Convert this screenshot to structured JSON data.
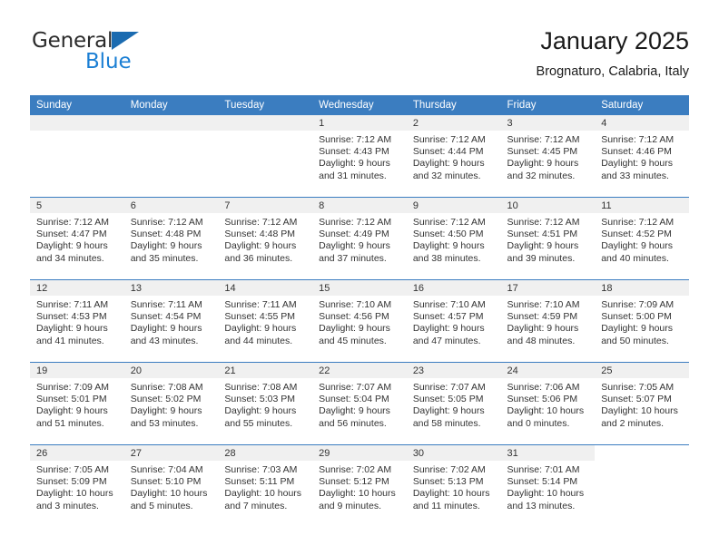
{
  "brand": {
    "name_top": "General",
    "name_bottom": "Blue",
    "triangle_color": "#1b6bb0",
    "blue_color": "#1b7fd4"
  },
  "header": {
    "title": "January 2025",
    "subtitle": "Brognaturo, Calabria, Italy"
  },
  "theme": {
    "header_blue": "#3b7dc0",
    "day_band_gray": "#f0f0f0",
    "text": "#333333"
  },
  "weekday_headers": [
    "Sunday",
    "Monday",
    "Tuesday",
    "Wednesday",
    "Thursday",
    "Friday",
    "Saturday"
  ],
  "labels": {
    "sunrise_prefix": "Sunrise:",
    "sunset_prefix": "Sunset:",
    "daylight_prefix": "Daylight:"
  },
  "weeks": [
    {
      "days": [
        {
          "num": "",
          "blank": true,
          "band": "gray",
          "lines": []
        },
        {
          "num": "",
          "blank": true,
          "band": "gray",
          "lines": []
        },
        {
          "num": "",
          "blank": true,
          "band": "gray",
          "lines": []
        },
        {
          "num": "1",
          "blank": false,
          "band": "gray",
          "lines": [
            "Sunrise: 7:12 AM",
            "Sunset: 4:43 PM",
            "Daylight: 9 hours",
            "and 31 minutes."
          ]
        },
        {
          "num": "2",
          "blank": false,
          "band": "gray",
          "lines": [
            "Sunrise: 7:12 AM",
            "Sunset: 4:44 PM",
            "Daylight: 9 hours",
            "and 32 minutes."
          ]
        },
        {
          "num": "3",
          "blank": false,
          "band": "gray",
          "lines": [
            "Sunrise: 7:12 AM",
            "Sunset: 4:45 PM",
            "Daylight: 9 hours",
            "and 32 minutes."
          ]
        },
        {
          "num": "4",
          "blank": false,
          "band": "gray",
          "lines": [
            "Sunrise: 7:12 AM",
            "Sunset: 4:46 PM",
            "Daylight: 9 hours",
            "and 33 minutes."
          ]
        }
      ]
    },
    {
      "days": [
        {
          "num": "5",
          "blank": false,
          "band": "gray",
          "lines": [
            "Sunrise: 7:12 AM",
            "Sunset: 4:47 PM",
            "Daylight: 9 hours",
            "and 34 minutes."
          ]
        },
        {
          "num": "6",
          "blank": false,
          "band": "gray",
          "lines": [
            "Sunrise: 7:12 AM",
            "Sunset: 4:48 PM",
            "Daylight: 9 hours",
            "and 35 minutes."
          ]
        },
        {
          "num": "7",
          "blank": false,
          "band": "gray",
          "lines": [
            "Sunrise: 7:12 AM",
            "Sunset: 4:48 PM",
            "Daylight: 9 hours",
            "and 36 minutes."
          ]
        },
        {
          "num": "8",
          "blank": false,
          "band": "gray",
          "lines": [
            "Sunrise: 7:12 AM",
            "Sunset: 4:49 PM",
            "Daylight: 9 hours",
            "and 37 minutes."
          ]
        },
        {
          "num": "9",
          "blank": false,
          "band": "gray",
          "lines": [
            "Sunrise: 7:12 AM",
            "Sunset: 4:50 PM",
            "Daylight: 9 hours",
            "and 38 minutes."
          ]
        },
        {
          "num": "10",
          "blank": false,
          "band": "gray",
          "lines": [
            "Sunrise: 7:12 AM",
            "Sunset: 4:51 PM",
            "Daylight: 9 hours",
            "and 39 minutes."
          ]
        },
        {
          "num": "11",
          "blank": false,
          "band": "gray",
          "lines": [
            "Sunrise: 7:12 AM",
            "Sunset: 4:52 PM",
            "Daylight: 9 hours",
            "and 40 minutes."
          ]
        }
      ]
    },
    {
      "days": [
        {
          "num": "12",
          "blank": false,
          "band": "gray",
          "lines": [
            "Sunrise: 7:11 AM",
            "Sunset: 4:53 PM",
            "Daylight: 9 hours",
            "and 41 minutes."
          ]
        },
        {
          "num": "13",
          "blank": false,
          "band": "gray",
          "lines": [
            "Sunrise: 7:11 AM",
            "Sunset: 4:54 PM",
            "Daylight: 9 hours",
            "and 43 minutes."
          ]
        },
        {
          "num": "14",
          "blank": false,
          "band": "gray",
          "lines": [
            "Sunrise: 7:11 AM",
            "Sunset: 4:55 PM",
            "Daylight: 9 hours",
            "and 44 minutes."
          ]
        },
        {
          "num": "15",
          "blank": false,
          "band": "gray",
          "lines": [
            "Sunrise: 7:10 AM",
            "Sunset: 4:56 PM",
            "Daylight: 9 hours",
            "and 45 minutes."
          ]
        },
        {
          "num": "16",
          "blank": false,
          "band": "gray",
          "lines": [
            "Sunrise: 7:10 AM",
            "Sunset: 4:57 PM",
            "Daylight: 9 hours",
            "and 47 minutes."
          ]
        },
        {
          "num": "17",
          "blank": false,
          "band": "gray",
          "lines": [
            "Sunrise: 7:10 AM",
            "Sunset: 4:59 PM",
            "Daylight: 9 hours",
            "and 48 minutes."
          ]
        },
        {
          "num": "18",
          "blank": false,
          "band": "gray",
          "lines": [
            "Sunrise: 7:09 AM",
            "Sunset: 5:00 PM",
            "Daylight: 9 hours",
            "and 50 minutes."
          ]
        }
      ]
    },
    {
      "days": [
        {
          "num": "19",
          "blank": false,
          "band": "gray",
          "lines": [
            "Sunrise: 7:09 AM",
            "Sunset: 5:01 PM",
            "Daylight: 9 hours",
            "and 51 minutes."
          ]
        },
        {
          "num": "20",
          "blank": false,
          "band": "gray",
          "lines": [
            "Sunrise: 7:08 AM",
            "Sunset: 5:02 PM",
            "Daylight: 9 hours",
            "and 53 minutes."
          ]
        },
        {
          "num": "21",
          "blank": false,
          "band": "gray",
          "lines": [
            "Sunrise: 7:08 AM",
            "Sunset: 5:03 PM",
            "Daylight: 9 hours",
            "and 55 minutes."
          ]
        },
        {
          "num": "22",
          "blank": false,
          "band": "gray",
          "lines": [
            "Sunrise: 7:07 AM",
            "Sunset: 5:04 PM",
            "Daylight: 9 hours",
            "and 56 minutes."
          ]
        },
        {
          "num": "23",
          "blank": false,
          "band": "gray",
          "lines": [
            "Sunrise: 7:07 AM",
            "Sunset: 5:05 PM",
            "Daylight: 9 hours",
            "and 58 minutes."
          ]
        },
        {
          "num": "24",
          "blank": false,
          "band": "gray",
          "lines": [
            "Sunrise: 7:06 AM",
            "Sunset: 5:06 PM",
            "Daylight: 10 hours",
            "and 0 minutes."
          ]
        },
        {
          "num": "25",
          "blank": false,
          "band": "gray",
          "lines": [
            "Sunrise: 7:05 AM",
            "Sunset: 5:07 PM",
            "Daylight: 10 hours",
            "and 2 minutes."
          ]
        }
      ]
    },
    {
      "days": [
        {
          "num": "26",
          "blank": false,
          "band": "gray",
          "lines": [
            "Sunrise: 7:05 AM",
            "Sunset: 5:09 PM",
            "Daylight: 10 hours",
            "and 3 minutes."
          ]
        },
        {
          "num": "27",
          "blank": false,
          "band": "gray",
          "lines": [
            "Sunrise: 7:04 AM",
            "Sunset: 5:10 PM",
            "Daylight: 10 hours",
            "and 5 minutes."
          ]
        },
        {
          "num": "28",
          "blank": false,
          "band": "gray",
          "lines": [
            "Sunrise: 7:03 AM",
            "Sunset: 5:11 PM",
            "Daylight: 10 hours",
            "and 7 minutes."
          ]
        },
        {
          "num": "29",
          "blank": false,
          "band": "gray",
          "lines": [
            "Sunrise: 7:02 AM",
            "Sunset: 5:12 PM",
            "Daylight: 10 hours",
            "and 9 minutes."
          ]
        },
        {
          "num": "30",
          "blank": false,
          "band": "gray",
          "lines": [
            "Sunrise: 7:02 AM",
            "Sunset: 5:13 PM",
            "Daylight: 10 hours",
            "and 11 minutes."
          ]
        },
        {
          "num": "31",
          "blank": false,
          "band": "gray",
          "lines": [
            "Sunrise: 7:01 AM",
            "Sunset: 5:14 PM",
            "Daylight: 10 hours",
            "and 13 minutes."
          ]
        },
        {
          "num": "",
          "blank": true,
          "band": "white",
          "lines": []
        }
      ]
    }
  ]
}
